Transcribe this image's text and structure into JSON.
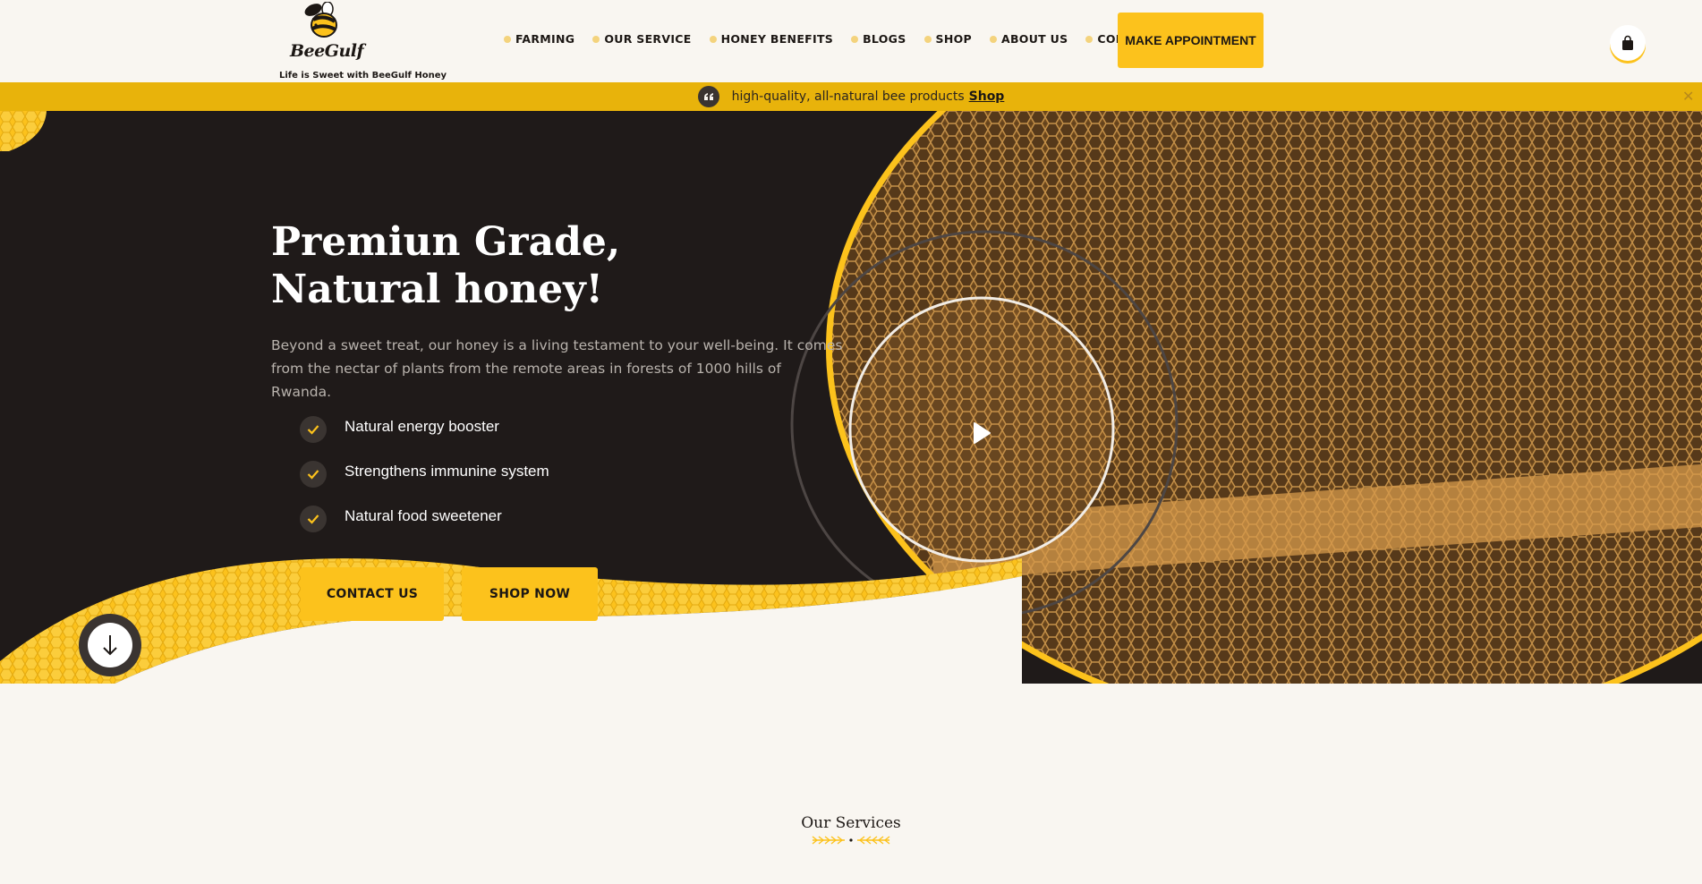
{
  "header": {
    "logo": {
      "brand": "BeeGulf",
      "tagline": "Life is Sweet with BeeGulf Honey"
    },
    "nav": [
      {
        "label": "FARMING"
      },
      {
        "label": "OUR SERVICE"
      },
      {
        "label": "HONEY BENEFITS"
      },
      {
        "label": "BLOGS"
      },
      {
        "label": "SHOP"
      },
      {
        "label": "ABOUT US"
      },
      {
        "label": "CONTACT"
      }
    ],
    "cta_label": "MAKE APPOINTMENT",
    "cart_icon": "shopping-bag-icon"
  },
  "announcement": {
    "icon": "quote-icon",
    "text": "high-quality, all-natural bee products",
    "link_label": "Shop",
    "close_icon": "close-icon"
  },
  "hero": {
    "title": "Premiun Grade, Natural honey!",
    "description": "Beyond a sweet treat, our honey is a living testament to your well-being. It comes from the nectar of plants from the remote areas in forests of 1000 hills of Rwanda.",
    "features": [
      {
        "label": "Natural energy booster"
      },
      {
        "label": "Strengthens immunine system"
      },
      {
        "label": "Natural food sweetener"
      }
    ],
    "buttons": {
      "contact": "CONTACT US",
      "shop": "SHOP NOW"
    },
    "scroll_icon": "arrow-down-icon",
    "play_icon": "play-icon"
  },
  "services": {
    "title": "Our Services"
  },
  "colors": {
    "accent": "#fcc21c",
    "dark": "#1f1a19",
    "announce_bar": "#e8b30b",
    "background": "#f9f6f1"
  }
}
